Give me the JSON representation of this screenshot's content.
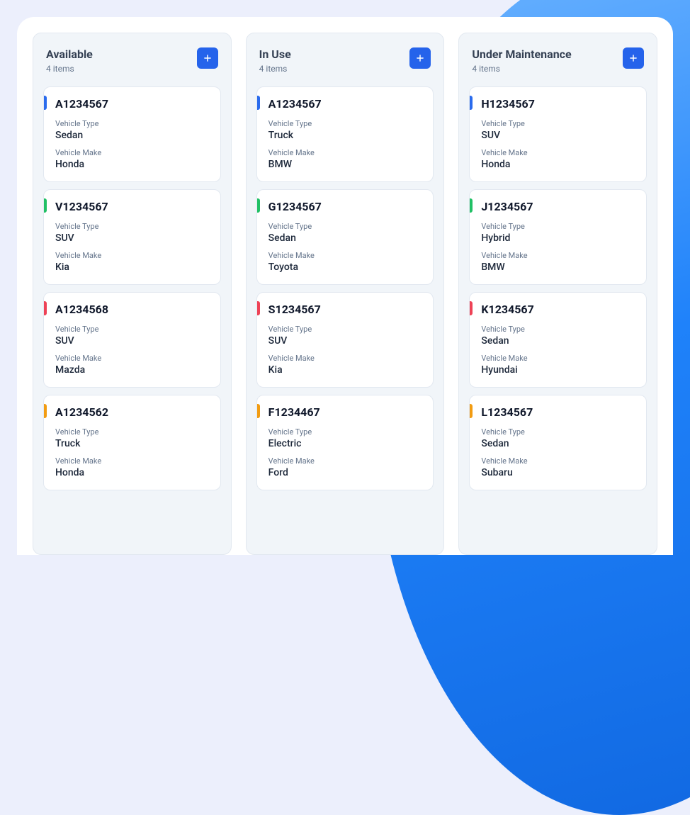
{
  "labels": {
    "vehicle_type": "Vehicle Type",
    "vehicle_make": "Vehicle Make",
    "items_suffix": "items"
  },
  "columns": [
    {
      "title": "Available",
      "count": 4,
      "cards": [
        {
          "id": "A1234567",
          "vehicleType": "Sedan",
          "vehicleMake": "Honda",
          "stripe": "blue"
        },
        {
          "id": "V1234567",
          "vehicleType": "SUV",
          "vehicleMake": "Kia",
          "stripe": "green"
        },
        {
          "id": "A1234568",
          "vehicleType": "SUV",
          "vehicleMake": "Mazda",
          "stripe": "red"
        },
        {
          "id": "A1234562",
          "vehicleType": "Truck",
          "vehicleMake": "Honda",
          "stripe": "orange"
        }
      ]
    },
    {
      "title": "In Use",
      "count": 4,
      "cards": [
        {
          "id": "A1234567",
          "vehicleType": "Truck",
          "vehicleMake": "BMW",
          "stripe": "blue"
        },
        {
          "id": "G1234567",
          "vehicleType": "Sedan",
          "vehicleMake": "Toyota",
          "stripe": "green"
        },
        {
          "id": "S1234567",
          "vehicleType": "SUV",
          "vehicleMake": "Kia",
          "stripe": "red"
        },
        {
          "id": "F1234467",
          "vehicleType": "Electric",
          "vehicleMake": "Ford",
          "stripe": "orange"
        }
      ]
    },
    {
      "title": "Under Maintenance",
      "count": 4,
      "cards": [
        {
          "id": "H1234567",
          "vehicleType": "SUV",
          "vehicleMake": "Honda",
          "stripe": "blue"
        },
        {
          "id": "J1234567",
          "vehicleType": "Hybrid",
          "vehicleMake": "BMW",
          "stripe": "green"
        },
        {
          "id": "K1234567",
          "vehicleType": "Sedan",
          "vehicleMake": "Hyundai",
          "stripe": "red"
        },
        {
          "id": "L1234567",
          "vehicleType": "Sedan",
          "vehicleMake": "Subaru",
          "stripe": "orange"
        }
      ]
    }
  ]
}
